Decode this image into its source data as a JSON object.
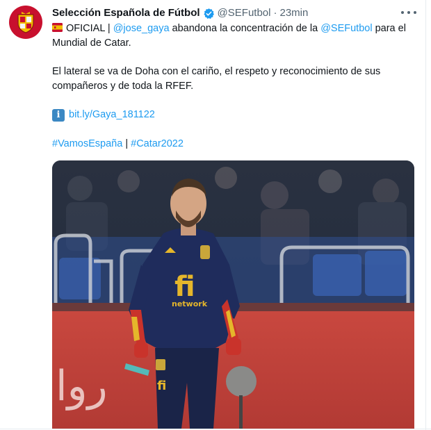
{
  "tweet": {
    "display_name": "Selección Española de Fútbol",
    "handle": "@SEFutbol",
    "separator": "·",
    "time": "23min",
    "line1_prefix": "OFICIAL | ",
    "mention_player": "@jose_gaya",
    "line1_mid": " abandona la concentración de la ",
    "mention_team": "@SEFutbol",
    "line1_suffix": " para el Mundial de Catar.",
    "paragraph2": "El lateral se va de Doha con el cariño, el respeto y reconocimiento de sus compañeros y de toda la RFEF.",
    "link_text": "bit.ly/Gaya_181122",
    "hashtag1": "#VamosEspaña",
    "hashtag_separator": " | ",
    "hashtag2": "#Catar2022",
    "info_icon_glyph": "i",
    "media": {
      "shirt_text": "fi",
      "shirt_sub": "network",
      "board_text": "ﺭﻭﺍ"
    }
  },
  "icons": {
    "avatar": "rfef-crest-icon",
    "verified": "verified-badge-icon",
    "more": "more-options-icon",
    "flag": "spain-flag-icon",
    "info": "information-icon"
  },
  "colors": {
    "link": "#1d9bf0",
    "verified": "#1d9bf0",
    "avatar_bg": "#c8102e",
    "text": "#0f1419",
    "muted": "#536471"
  }
}
